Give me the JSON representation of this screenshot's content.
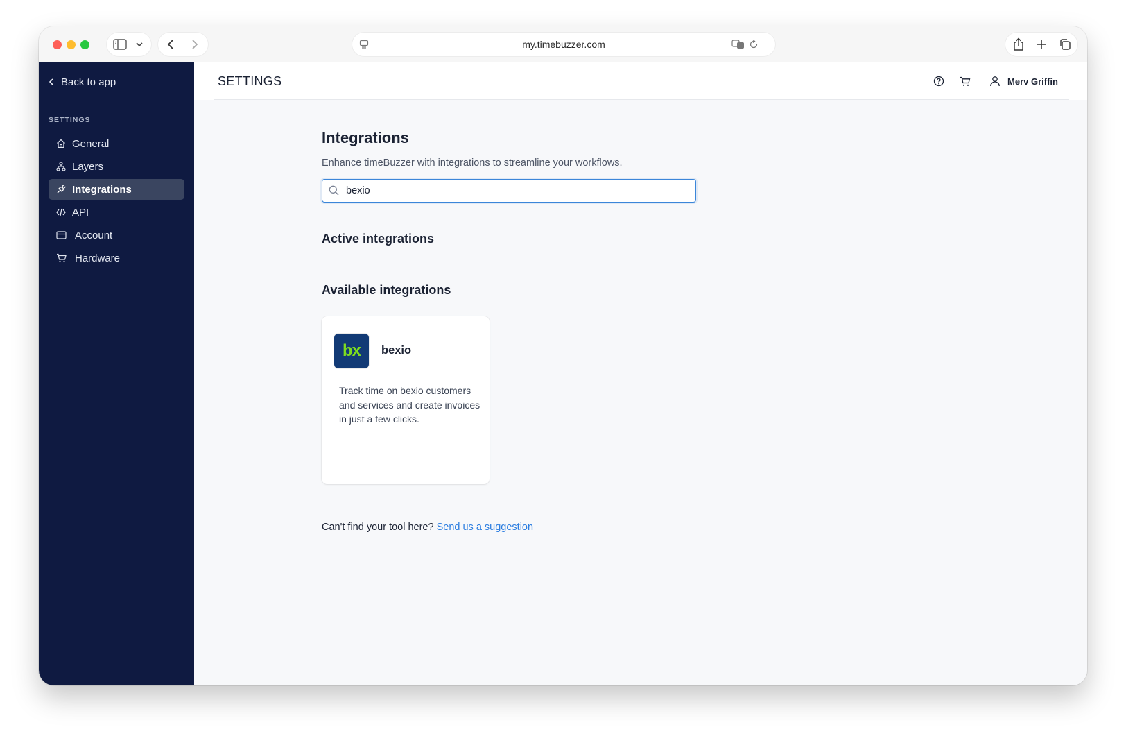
{
  "browser": {
    "url": "my.timebuzzer.com"
  },
  "sidebar": {
    "back_label": "Back to app",
    "section_label": "SETTINGS",
    "items": [
      {
        "label": "General",
        "icon": "home-icon",
        "active": false
      },
      {
        "label": "Layers",
        "icon": "layers-icon",
        "active": false
      },
      {
        "label": "Integrations",
        "icon": "plug-icon",
        "active": true
      },
      {
        "label": "API",
        "icon": "code-icon",
        "active": false
      },
      {
        "label": "Account",
        "icon": "card-icon",
        "active": false
      },
      {
        "label": "Hardware",
        "icon": "cart-icon",
        "active": false
      }
    ]
  },
  "header": {
    "title": "SETTINGS",
    "user_name": "Merv Griffin"
  },
  "main": {
    "title": "Integrations",
    "subtitle": "Enhance timeBuzzer with integrations to streamline your workflows.",
    "search": {
      "value": "bexio",
      "placeholder": ""
    },
    "active_heading": "Active integrations",
    "available_heading": "Available integrations",
    "cards": [
      {
        "logo_text": "bx",
        "name": "bexio",
        "description": "Track time on bexio customers and services and create invoices in just a few clicks."
      }
    ],
    "suggest_text": "Can't find your tool here?",
    "suggest_link": "Send us a suggestion"
  },
  "colors": {
    "sidebar_bg": "#0f1a41",
    "active_item_bg": "#3a4560",
    "accent": "#2b7de0",
    "bexio_logo_bg": "#123a75",
    "bexio_logo_fg": "#7ddc1f"
  }
}
